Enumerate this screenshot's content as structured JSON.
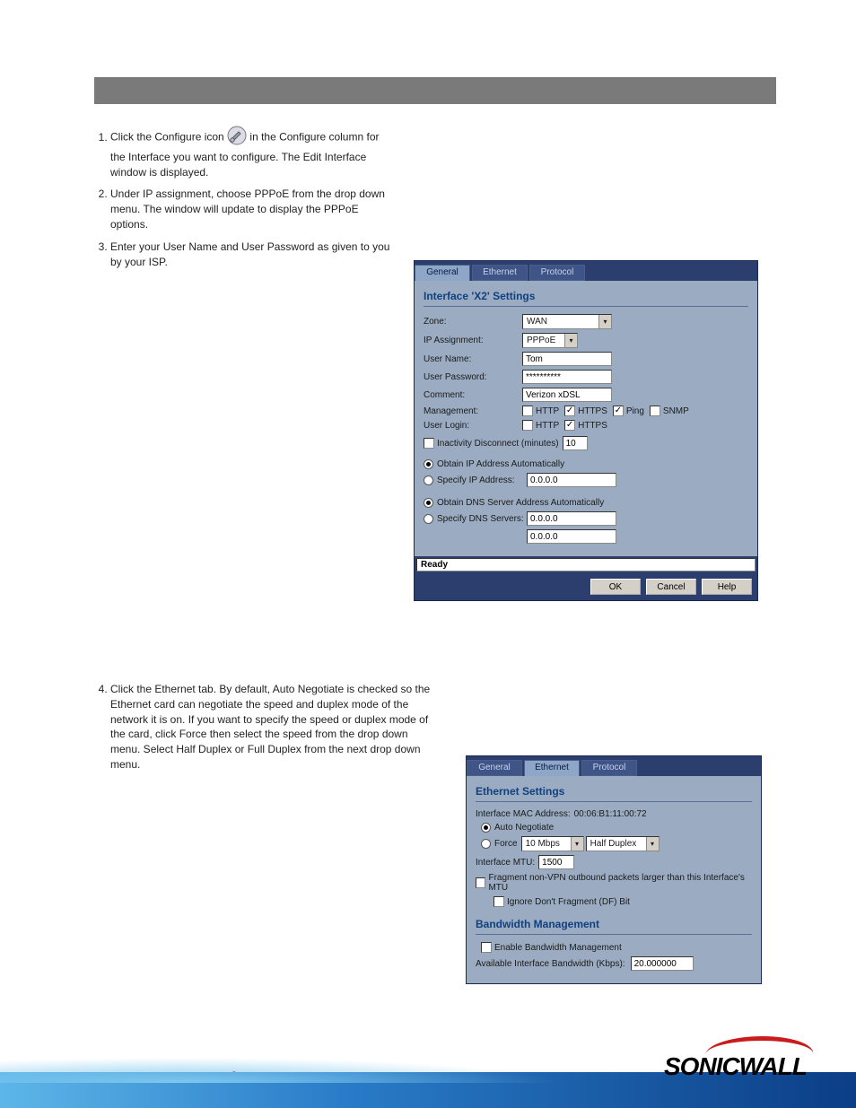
{
  "instructions_before_dialog1": [
    {
      "text_prefix": "Click the Configure icon ",
      "text_suffix": " in the Configure column for the Interface you want to configure. The Edit Interface window is displayed."
    },
    {
      "text": "Under IP assignment, choose PPPoE from the drop down menu. The window will update to display the PPPoE options."
    },
    {
      "text": "Enter your User Name and User Password as given to you by your ISP."
    }
  ],
  "instructions_after_dialog1": [
    {
      "text": "Click the Ethernet tab. By default, Auto Negotiate is checked so the Ethernet card can negotiate the speed and duplex mode of the network it is on. If you want to specify the speed or duplex mode of the card, click Force then select the speed from the drop down menu. Select Half Duplex or Full Duplex from the next drop down menu."
    }
  ],
  "dialog1": {
    "tabs": {
      "general": "General",
      "ethernet": "Ethernet",
      "protocol": "Protocol",
      "active": "general"
    },
    "section_title": "Interface 'X2' Settings",
    "zone_label": "Zone:",
    "zone_value": "WAN",
    "ipassign_label": "IP Assignment:",
    "ipassign_value": "PPPoE",
    "username_label": "User Name:",
    "username_value": "Tom",
    "userpass_label": "User Password:",
    "userpass_value": "**********",
    "comment_label": "Comment:",
    "comment_value": "Verizon xDSL",
    "mgmt_label": "Management:",
    "mgmt_opts": {
      "http": "HTTP",
      "https": "HTTPS",
      "ping": "Ping",
      "snmp": "SNMP"
    },
    "userlogin_label": "User Login:",
    "userlogin_opts": {
      "http": "HTTP",
      "https": "HTTPS"
    },
    "inactivity_label": "Inactivity Disconnect (minutes)",
    "inactivity_value": "10",
    "obtain_ip": "Obtain IP Address Automatically",
    "specify_ip_label": "Specify IP Address:",
    "specify_ip_value": "0.0.0.0",
    "obtain_dns": "Obtain DNS Server Address Automatically",
    "specify_dns_label": "Specify DNS Servers:",
    "dns1": "0.0.0.0",
    "dns2": "0.0.0.0",
    "status": "Ready",
    "buttons": {
      "ok": "OK",
      "cancel": "Cancel",
      "help": "Help"
    }
  },
  "dialog2": {
    "tabs": {
      "general": "General",
      "ethernet": "Ethernet",
      "protocol": "Protocol",
      "active": "ethernet"
    },
    "section_title": "Ethernet Settings",
    "mac_label": "Interface MAC Address:",
    "mac_value": "00:06:B1:11:00:72",
    "auto_neg": "Auto Negotiate",
    "force_label": "Force",
    "speed_value": "10 Mbps",
    "duplex_value": "Half Duplex",
    "mtu_label": "Interface MTU:",
    "mtu_value": "1500",
    "fragment_label": "Fragment non-VPN outbound packets larger than this Interface's MTU",
    "ignore_df_label": "Ignore Don't Fragment (DF) Bit",
    "bw_title": "Bandwidth Management",
    "enable_bw": "Enable Bandwidth Management",
    "avail_bw_label": "Available Interface Bandwidth (Kbps):",
    "avail_bw_value": "20.000000"
  },
  "footer": {
    "logo": "SONICWALL"
  }
}
